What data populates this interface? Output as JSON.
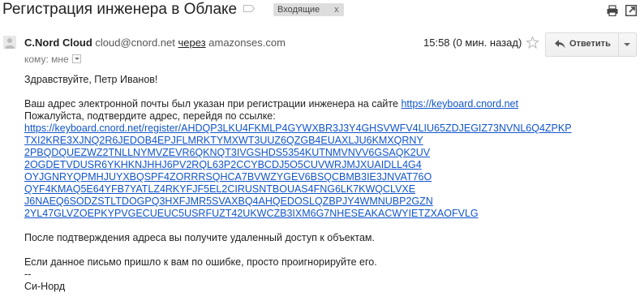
{
  "subject": "Регистрация инженера в Облаке",
  "label_chip": {
    "label": "Входящие",
    "remove": "x"
  },
  "sender": {
    "name": "C.Nord Cloud",
    "email": "cloud@cnord.net",
    "via_label": "через",
    "via_domain": "amazonses.com"
  },
  "to": {
    "label": "кому: мне"
  },
  "time": "15:58 (0 мин. назад)",
  "reply_button": {
    "label": "Ответить"
  },
  "body": {
    "greeting": "Здравствуйте, Петр Иванов!",
    "line1_text": "Ваш адрес электронной почты был указан при регистрации инженера на сайте ",
    "site_link": "https://keyboard.cnord.net",
    "line2": "Пожалуйста, подтвердите адрес, перейдя по ссылке:",
    "confirm_url_lines": [
      "https://keyboard.cnord.net/register/AHDQP3LKU4FKMLP4GYWXBR3J3Y4GHSVWFV4LIU65ZDJEGIZ73NVNL6Q4ZPKP",
      "TXI2KRE3XJNQ2R6JEDOB4EPJFLMRKTYMXWT3UUZ6QZGB4EUAXLJU6KMXQRNY",
      "2PBQDQUEZWZ2TNLLNYMVZEVR6QKNQT3IVGSHDS5354KUTNMVNVV6GSAQK2UV",
      "2OGDETVDUSR6YKHKNJHHJ6PV2RQL63P2CCYBCDJ5O5CUVWRJMJXUAIDLL4G4",
      "OYJGNRYQPMHJUYXBQSPF4ZORRRSQHCA7BVWZYGEV6BSQCBMB3IE3JNVAT76O",
      "QYF4KMAQ5E64YFB7YATLZ4RKYFJF5EL2CIRUSNTBOUAS4FNG6LK7KWQCLVXE",
      "J6NAEQ6SODZSTLTDOGPQ3HXFJMR5SVAXBQ4AHQEDOSLQZBPJY4WMNUBP2GZN",
      "2YL47GLVZOEPKYPVGECUEUC5USRFUZT42UKWCZB3IXM6G7NHESEAKACWYIETZXAOFVLG"
    ],
    "after_confirm": "После подтверждения адреса вы получите удаленный доступ к объектам.",
    "mistake": "Если данное письмо пришло к вам по ошибке, просто проигнорируйте его.",
    "sig_sep": "--",
    "signature": "Си-Норд"
  }
}
